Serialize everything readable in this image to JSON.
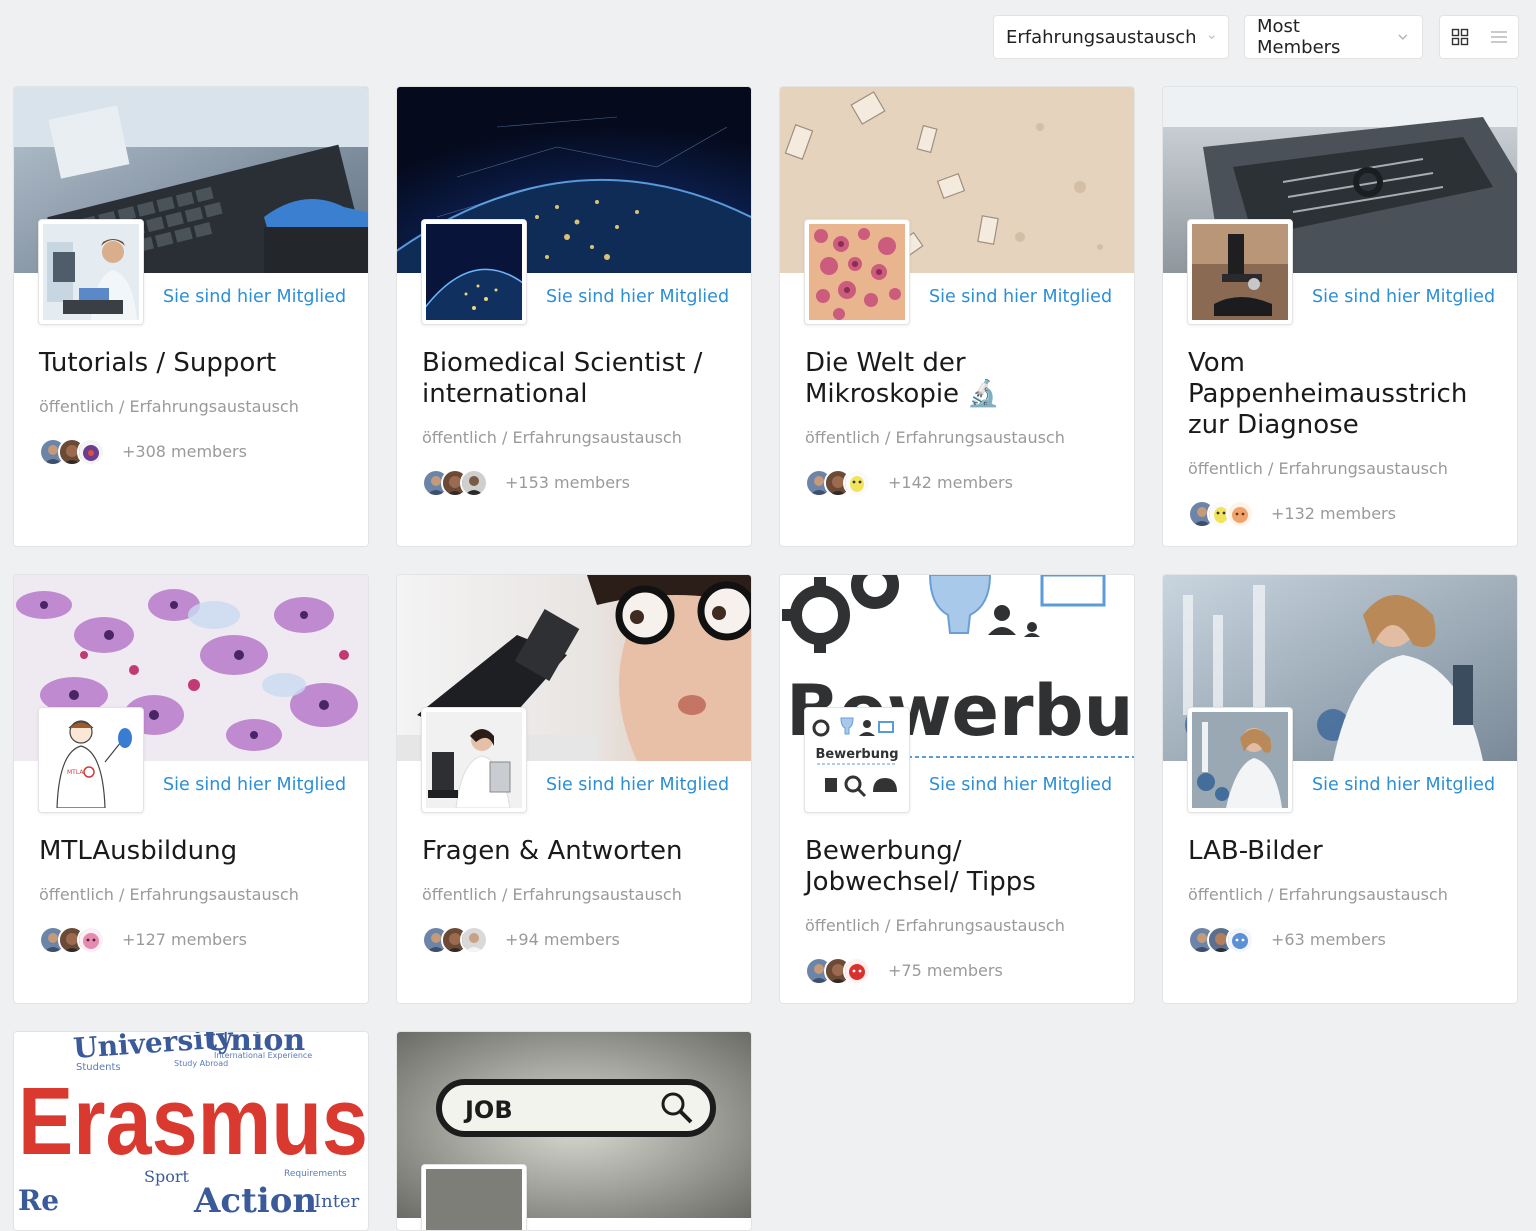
{
  "filters": {
    "group_type": "Erfahrungsaustausch",
    "order_by": "Most Members",
    "grid_view_icon": "grid-icon",
    "list_view_icon": "list-icon"
  },
  "colors": {
    "accent": "#2b8fd6",
    "background": "#eff0f2",
    "meta": "#9a9a9a"
  },
  "member_label": "Sie sind hier Mitglied",
  "groups": [
    {
      "title": "Tutorials / Support",
      "meta": "öffentlich / Erfahrungsaustausch",
      "members": "+308 members",
      "cover": "keyboard-lab",
      "avatar": "scientist-computer"
    },
    {
      "title": "Biomedical Scientist / international",
      "meta": "öffentlich / Erfahrungsaustausch",
      "members": "+153 members",
      "cover": "earth-night",
      "avatar": "earth-night"
    },
    {
      "title": "Die Welt der Mikroskopie 🔬",
      "meta": "öffentlich / Erfahrungsaustausch",
      "members": "+142 members",
      "cover": "crystals-microscope",
      "avatar": "cells-stain"
    },
    {
      "title": "Vom Pappenheimausstrich zur Diagnose",
      "meta": "öffentlich / Erfahrungsaustausch",
      "members": "+132 members",
      "cover": "lab-instrument",
      "avatar": "microscope-photo"
    },
    {
      "title": "MTLAusbildung",
      "meta": "öffentlich / Erfahrungsaustausch",
      "members": "+127 members",
      "cover": "cytology-stain",
      "avatar": "mtla-cartoon"
    },
    {
      "title": "Fragen & Antworten",
      "meta": "öffentlich / Erfahrungsaustausch",
      "members": "+94 members",
      "cover": "woman-microscope",
      "avatar": "woman-tablet"
    },
    {
      "title": "Bewerbung/ Jobwechsel/ Tipps",
      "meta": "öffentlich / Erfahrungsaustausch",
      "members": "+75 members",
      "cover": "bewerbung-text",
      "avatar": "bewerbung-icons",
      "cover_text": "Bewerbung",
      "avatar_text": "Bewerbung"
    },
    {
      "title": "LAB-Bilder",
      "meta": "öffentlich / Erfahrungsaustausch",
      "members": "+63 members",
      "cover": "lab-pipette",
      "avatar": "lab-pipette"
    },
    {
      "title": "",
      "meta": "",
      "members": "",
      "cover": "erasmus-wordcloud",
      "avatar": "",
      "cover_text": "Erasmus"
    },
    {
      "title": "",
      "meta": "",
      "members": "",
      "cover": "job-searchbar",
      "avatar": "",
      "cover_text": "JOB"
    }
  ]
}
